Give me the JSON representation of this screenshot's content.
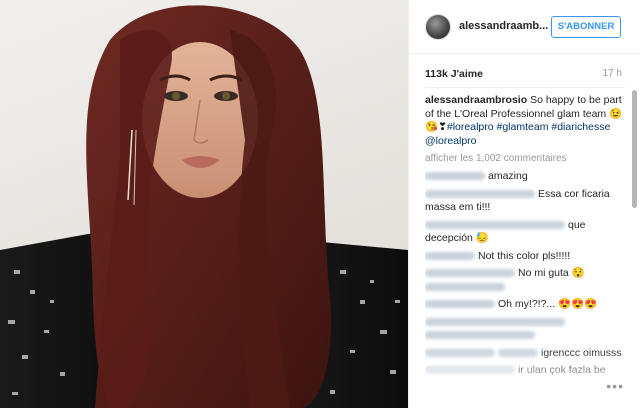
{
  "post": {
    "username": "alessandraamb...",
    "follow_label": "S'ABONNER",
    "likes": "113k J'aime",
    "time_ago": "17 h"
  },
  "caption": {
    "user": "alessandraambrosio",
    "text": "So happy to be part of the L'Oreal Professionnel glam team",
    "emoji": "😉😘❣",
    "tags": [
      "#lorealpro",
      "#glamteam",
      "#diarichesse",
      "@lorealpro"
    ]
  },
  "load_more": "afficher les 1,002 commentaires",
  "comments": [
    {
      "text": "amazing"
    },
    {
      "text": "Essa cor ficaria massa em ti!!!"
    },
    {
      "text": "que decepción 😓"
    },
    {
      "text": "Not this color pls!!!!!"
    },
    {
      "text": "No mi guta 😯"
    },
    {
      "text": "Oh my!?!?... 😍😍😍"
    },
    {
      "text": "igrenccc oimusss"
    },
    {
      "text": "ir ulan çok fazla be"
    }
  ],
  "more_options_icon": "ellipsis-icon",
  "colors": {
    "accent": "#3897f0",
    "hashtag": "#003569",
    "muted": "#999999"
  }
}
